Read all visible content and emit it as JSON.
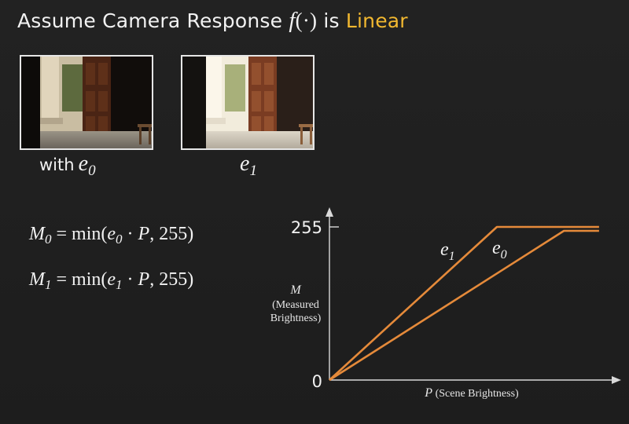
{
  "slide": {
    "title": {
      "prefix": "Assume Camera Response ",
      "function_name": "f",
      "function_arg": "(·)",
      "middle": " is ",
      "highlight": "Linear"
    },
    "accent_color": "#f2b830",
    "curve_color": "#e58a3a"
  },
  "photos": [
    {
      "caption_word": "with",
      "exposure": "e",
      "exposure_index": "0",
      "relative_brightness": 0.55
    },
    {
      "caption_word": "",
      "exposure": "e",
      "exposure_index": "1",
      "relative_brightness": 1.0
    }
  ],
  "equations": [
    {
      "lhs": "M",
      "lhs_index": "0",
      "text_eq": " = min(",
      "e": "e",
      "e_index": "0",
      "dot": " · ",
      "p": "P",
      "tail": ", 255)"
    },
    {
      "lhs": "M",
      "lhs_index": "1",
      "text_eq": " = min(",
      "e": "e",
      "e_index": "1",
      "dot": " · ",
      "p": "P",
      "tail": ", 255)"
    }
  ],
  "chart_data": {
    "type": "line",
    "y_ticks": [
      "255",
      "0"
    ],
    "ylim": [
      0,
      255
    ],
    "ylabel": {
      "symbol": "M",
      "line1": "(Measured",
      "line2": "Brightness)"
    },
    "xlabel": {
      "symbol": "P",
      "text": "(Scene Brightness)"
    },
    "series": [
      {
        "name": "e",
        "index": "1",
        "points": [
          [
            0,
            0
          ],
          [
            1.0,
            255
          ],
          [
            1.61,
            255
          ]
        ],
        "label_position": "steep-segment"
      },
      {
        "name": "e",
        "index": "0",
        "points": [
          [
            0,
            0
          ],
          [
            1.4,
            255
          ],
          [
            1.61,
            255
          ]
        ],
        "label_position": "shallow-segment"
      }
    ]
  }
}
